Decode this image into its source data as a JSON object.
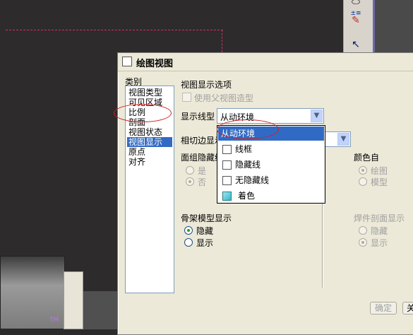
{
  "background": {
    "tm_label": "TM",
    "toolbar_glyphs": [
      "⬭",
      "±≡",
      "✎",
      "↖"
    ]
  },
  "dialog": {
    "title": "绘图视图",
    "category_label": "类别",
    "categories": [
      "视图类型",
      "可见区域",
      "比例",
      "剖面",
      "视图状态",
      "视图显示",
      "原点",
      "对齐"
    ],
    "selected_category": "视图显示",
    "section_title": "视图显示选项",
    "use_parent_style": "使用父视图造型",
    "display_style_label": "显示线型",
    "display_style_value": "从动环境",
    "tangent_label": "相切边显示",
    "hidden_line_label": "面组隐藏线",
    "yes_label": "是",
    "no_label": "否",
    "color_from_label": "颜色自",
    "drawing_label": "绘图",
    "model_label": "模型",
    "skeleton_label": "骨架模型显示",
    "hide_label": "隐藏",
    "show_label": "显示",
    "weld_label": "焊件剖面显示",
    "weld_hide": "隐藏",
    "weld_show": "显示",
    "ok_button": "确定",
    "close_button": "关"
  },
  "dropdown": {
    "items": [
      {
        "label": "从动环境",
        "icon": "none"
      },
      {
        "label": "线框",
        "icon": "wireframe-icon"
      },
      {
        "label": "隐藏线",
        "icon": "hidden-line-icon"
      },
      {
        "label": "无隐藏线",
        "icon": "no-hidden-icon"
      },
      {
        "label": "着色",
        "icon": "shaded-icon"
      }
    ],
    "selected": "从动环境"
  },
  "colors": {
    "selection": "#316ac5",
    "annotation": "#d02020",
    "dashed_line": "#d0306a"
  }
}
